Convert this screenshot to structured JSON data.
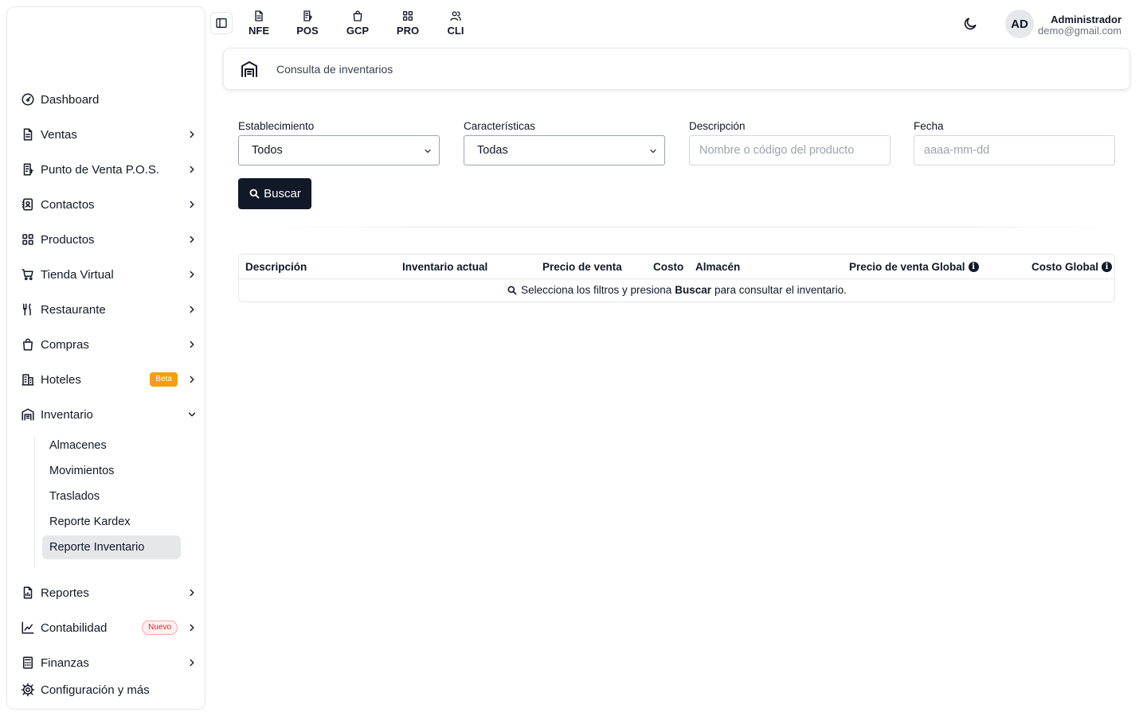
{
  "sidebar": {
    "items": [
      {
        "label": "Dashboard",
        "icon": "dashboard-icon"
      },
      {
        "label": "Ventas",
        "icon": "document-icon"
      },
      {
        "label": "Punto de Venta P.O.S.",
        "icon": "pos-icon"
      },
      {
        "label": "Contactos",
        "icon": "contacts-icon"
      },
      {
        "label": "Productos",
        "icon": "grid-icon"
      },
      {
        "label": "Tienda Virtual",
        "icon": "cart-icon"
      },
      {
        "label": "Restaurante",
        "icon": "utensils-icon"
      },
      {
        "label": "Compras",
        "icon": "bag-icon"
      },
      {
        "label": "Hoteles",
        "icon": "building-icon",
        "badge": "Beta"
      },
      {
        "label": "Inventario",
        "icon": "warehouse-icon"
      },
      {
        "label": "Reportes",
        "icon": "report-icon"
      },
      {
        "label": "Contabilidad",
        "icon": "chart-icon",
        "badge": "Nuevo"
      },
      {
        "label": "Finanzas",
        "icon": "calculator-icon"
      }
    ],
    "inventario_sub": [
      "Almacenes",
      "Movimientos",
      "Traslados",
      "Reporte Kardex",
      "Reporte Inventario"
    ],
    "settings_label": "Configuración y más"
  },
  "topbar": {
    "quick_links": [
      "NFE",
      "POS",
      "GCP",
      "PRO",
      "CLI"
    ],
    "avatar_initials": "AD",
    "user_name": "Administrador",
    "user_email": "demo@gmail.com"
  },
  "header": {
    "title": "Consulta de inventarios"
  },
  "filters": {
    "establecimiento": {
      "label": "Establecimiento",
      "value": "Todos"
    },
    "caracteristicas": {
      "label": "Características",
      "value": "Todas"
    },
    "descripcion": {
      "label": "Descripción",
      "placeholder": "Nombre o código del producto"
    },
    "fecha": {
      "label": "Fecha",
      "placeholder": "aaaa-mm-dd"
    },
    "search_button": "Buscar"
  },
  "table": {
    "columns": [
      "Descripción",
      "Inventario actual",
      "Precio de venta",
      "Costo",
      "Almacén",
      "Precio de venta Global",
      "Costo Global"
    ],
    "empty_pre": "Selecciona los filtros y presiona",
    "empty_bold": "Buscar",
    "empty_post": "para consultar el inventario."
  }
}
